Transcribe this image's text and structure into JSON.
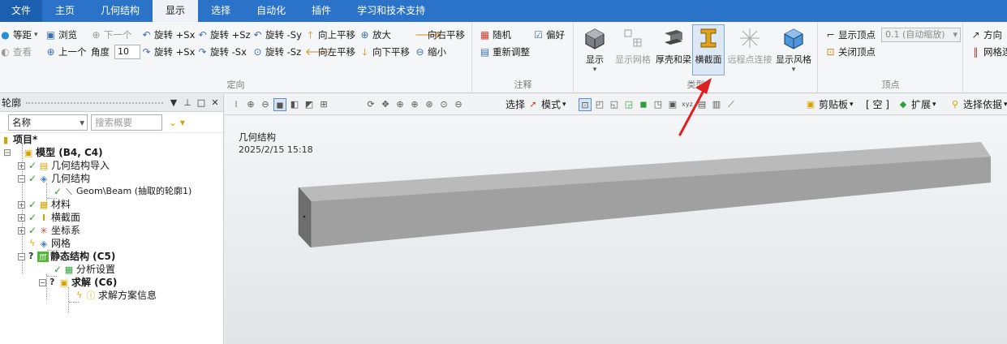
{
  "menu": {
    "tabs": [
      "文件",
      "主页",
      "几何结构",
      "显示",
      "选择",
      "自动化",
      "插件",
      "学习和技术支持"
    ],
    "active_index": 3
  },
  "ribbon": {
    "orient": {
      "label": "定向",
      "iso": "等距",
      "look": "查看",
      "browse": "浏览",
      "next": "下一个",
      "prev": "上一个",
      "angle_label": "角度",
      "angle_value": "10",
      "rot_px": "旋转 +Sx",
      "rot_pz": "旋转 +Sz",
      "rot_ny": "旋转 -Sy",
      "rot_px2": "旋转 +Sx",
      "rot_nx": "旋转 -Sx",
      "rot_nz": "旋转 -Sz",
      "pan_up": "向上平移",
      "pan_left": "向左平移",
      "zoom_in": "放大",
      "pan_down": "向下平移",
      "pan_right": "向右平移",
      "zoom_out": "缩小"
    },
    "annotate": {
      "label": "注释",
      "random": "随机",
      "prefer": "偏好",
      "readjust": "重新调整"
    },
    "type": {
      "label": "类型",
      "show": "显示",
      "show_mesh": "显示网格",
      "thick_beam": "厚壳和梁",
      "cross_section": "横截面",
      "remote_point": "远程点连接",
      "show_style": "显示风格"
    },
    "vertex": {
      "label": "顶点",
      "show_vertex": "显示顶点",
      "auto_scale": "0.1 (自动缩放)",
      "close_vertex": "关闭顶点"
    },
    "extra": {
      "direction": "方向",
      "mesh_conn": "网格连"
    }
  },
  "outline": {
    "title": "轮廓",
    "name_select": "名称",
    "search_placeholder": "搜索概要",
    "tree": {
      "project": "项目*",
      "model": "模型 (B4, C4)",
      "geom_import": "几何结构导入",
      "geometry": "几何结构",
      "geom_beam": "Geom\\Beam (抽取的轮廓1)",
      "materials": "材料",
      "cross_sections": "横截面",
      "coord_sys": "坐标系",
      "mesh": "网格",
      "static": "静态结构 (C5)",
      "analysis_settings": "分析设置",
      "solution": "求解 (C6)",
      "solution_info": "求解方案信息"
    }
  },
  "viewport": {
    "toolbar": {
      "select": "选择",
      "mode": "模式",
      "clipboard": "剪贴板",
      "empty": "[ 空 ]",
      "extend": "扩展",
      "select_by": "选择依据"
    },
    "title": "几何结构",
    "date": "2025/2/15 15:18"
  },
  "colors": {
    "menubar": "#2b73c8",
    "beam_top": "#b9b9b9",
    "beam_side": "#9a9a9a",
    "beam_end": "#6e6e6e",
    "arrow": "#e02020"
  }
}
